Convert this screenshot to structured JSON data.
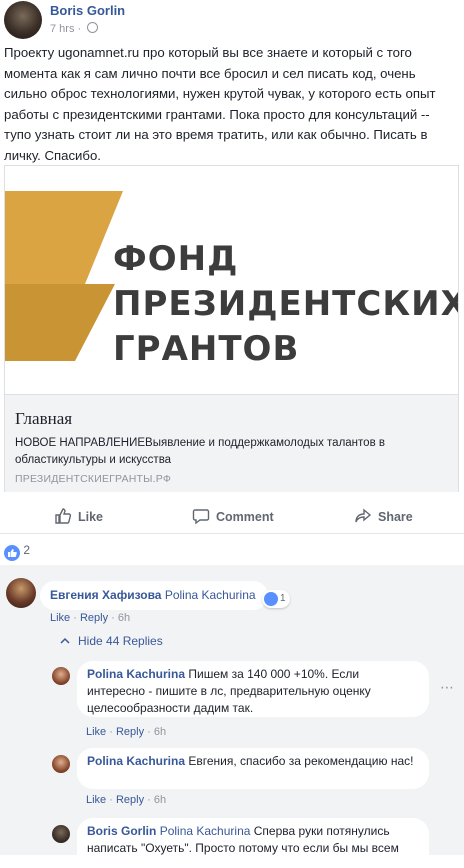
{
  "post": {
    "author": "Boris Gorlin",
    "time": "7 hrs",
    "dot": "·",
    "text": "Проекту ugonamnet.ru про который вы все знаете и который с того момента как я сам лично почти все бросил и сел писать код, очень сильно оброс технологиями, нужен крутой чувак, у которого есть опыт работы с президентскими грантами. Пока просто для консультаций -- тупо узнать стоит ли на это время тратить, или как обычно. Писать в личку. Спасибо."
  },
  "link": {
    "logo_line1": "ФОНД",
    "logo_line2": "ПРЕЗИДЕНТСКИХ",
    "logo_line3": "ГРАНТОВ",
    "title": "Главная",
    "description": "НОВОЕ НАПРАВЛЕНИЕВыявление и поддержкамолодых талантов в областикультуры и искусства",
    "domain": "ПРЕЗИДЕНТСКИЕГРАНТЫ.РФ"
  },
  "actions": {
    "like": "Like",
    "comment": "Comment",
    "share": "Share"
  },
  "reactions": {
    "count": "2"
  },
  "comments": [
    {
      "author": "Евгения Хафизова",
      "tag": "Polina Kachurina",
      "text": "",
      "likes": "1",
      "like": "Like",
      "reply": "Reply",
      "time": "6h"
    }
  ],
  "hide_replies": "Hide 44 Replies",
  "replies": [
    {
      "author": "Polina Kachurina",
      "text": "Пишем за 140 000 +10%. Если интересно - пишите в лс, предварительную оценку целесообразности дадим так.",
      "like": "Like",
      "reply": "Reply",
      "time": "6h"
    },
    {
      "author": "Polina Kachurina",
      "text": "Евгения, спасибо за рекомендацию нас!",
      "like": "Like",
      "reply": "Reply",
      "time": "6h"
    },
    {
      "author": "Boris Gorlin",
      "tag": "Polina Kachurina",
      "text": "Сперва руки потянулись написать \"Охуеть\". Просто потому что если бы мы всем"
    }
  ],
  "colors": {
    "link_blue": "#385898",
    "logo_gold": "#d9a441",
    "like_blue": "#5890ff"
  },
  "icons": [
    "globe-icon",
    "thumbs-up-icon",
    "comment-icon",
    "share-icon",
    "like-reaction-icon",
    "chevron-up-icon"
  ]
}
